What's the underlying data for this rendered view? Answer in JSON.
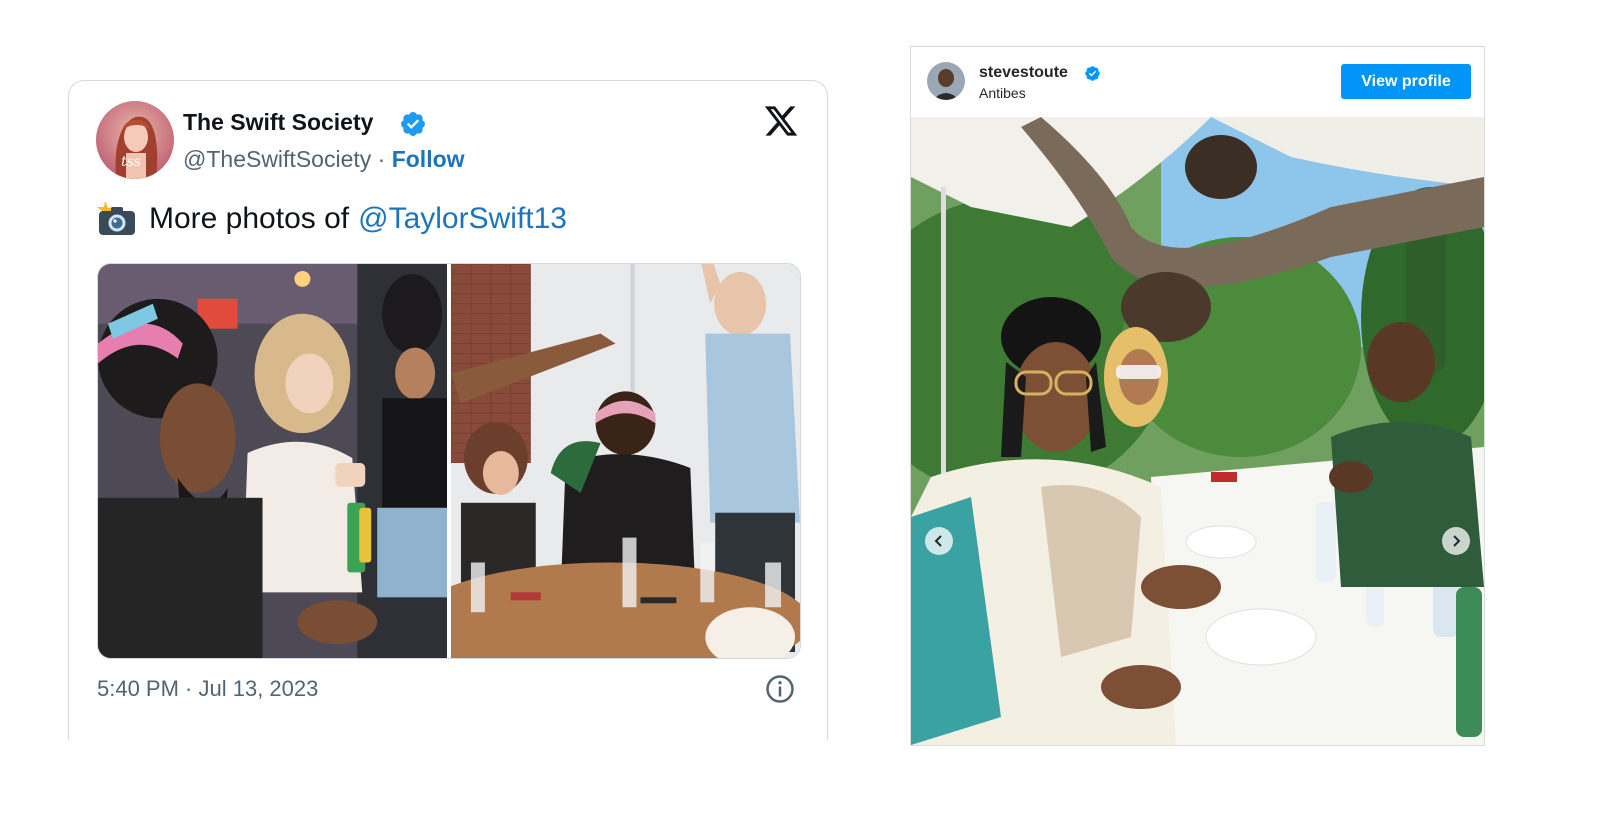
{
  "tweet": {
    "display_name": "The Swift Society",
    "handle": "@TheSwiftSociety",
    "separator": "·",
    "follow_label": "Follow",
    "avatar_initials": "tss",
    "text": "More photos of",
    "mention": "@TaylorSwift13",
    "timestamp": "5:40 PM · Jul 13, 2023",
    "icons": {
      "brand": "x-logo-icon",
      "emoji": "camera-flash-icon",
      "info": "info-icon",
      "verified": "verified-badge-icon"
    },
    "colors": {
      "link": "#1d74bd",
      "verified": "#1d9bf0",
      "secondary_text": "#536471"
    }
  },
  "instagram": {
    "username": "stevestoute",
    "location": "Antibes",
    "view_profile_label": "View profile",
    "icons": {
      "verified": "verified-badge-icon",
      "prev": "chevron-left-icon",
      "next": "chevron-right-icon"
    },
    "colors": {
      "button": "#0095f6",
      "verified": "#0095f6"
    }
  }
}
